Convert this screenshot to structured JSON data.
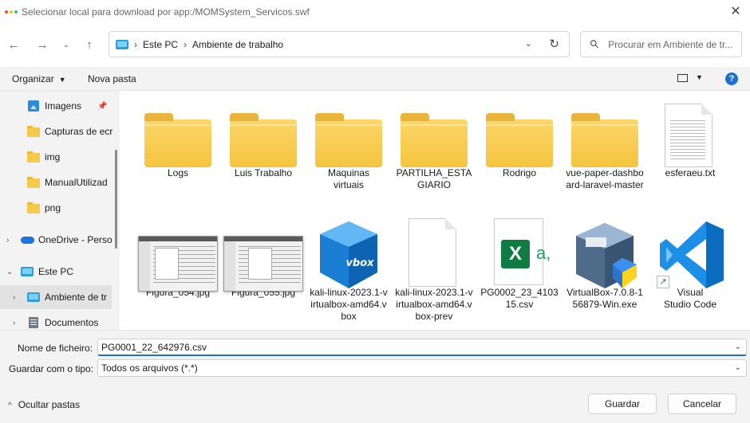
{
  "window": {
    "title": "Selecionar local para download por app:/MOMSystem_Servicos.swf",
    "close_glyph": "✕"
  },
  "nav": {
    "back_icon": "arrow-left-icon",
    "forward_icon": "arrow-right-icon",
    "recent_icon": "chevron-down-icon",
    "up_icon": "arrow-up-icon",
    "breadcrumbs": [
      "Este PC",
      "Ambiente de trabalho"
    ],
    "search_placeholder": "Procurar em Ambiente de tr..."
  },
  "toolbar": {
    "organize_label": "Organizar",
    "new_folder_label": "Nova pasta",
    "help_label": "?"
  },
  "sidebar": {
    "items": [
      {
        "label": "Imagens",
        "icon": "pictures-icon",
        "pinned": true
      },
      {
        "label": "Capturas de ecr",
        "icon": "folder-icon"
      },
      {
        "label": "img",
        "icon": "folder-icon"
      },
      {
        "label": "ManualUtilizad",
        "icon": "folder-icon"
      },
      {
        "label": "png",
        "icon": "folder-icon"
      },
      {
        "label": "OneDrive - Perso",
        "icon": "onedrive-icon",
        "expandable": true
      },
      {
        "label": "Este PC",
        "icon": "this-pc-icon",
        "expanded": true
      },
      {
        "label": "Ambiente de tr",
        "icon": "desktop-icon",
        "selected": true
      },
      {
        "label": "Documentos",
        "icon": "documents-icon"
      }
    ]
  },
  "files": [
    {
      "name": "Logs",
      "type": "folder"
    },
    {
      "name": "Luis Trabalho",
      "type": "folder"
    },
    {
      "name": "Maquinas virtuais",
      "type": "folder"
    },
    {
      "name": "PARTILHA_ESTAGIARIO",
      "type": "folder"
    },
    {
      "name": "Rodrigo",
      "type": "folder"
    },
    {
      "name": "vue-paper-dashboard-laravel-master",
      "type": "folder"
    },
    {
      "name": "esferaeu.txt",
      "type": "text"
    },
    {
      "name": "Figura_054.jpg",
      "type": "image"
    },
    {
      "name": "Figura_055.jpg",
      "type": "image"
    },
    {
      "name": "kali-linux-2023.1-virtualbox-amd64.vbox",
      "type": "vbox"
    },
    {
      "name": "kali-linux-2023.1-virtualbox-amd64.vbox-prev",
      "type": "blank"
    },
    {
      "name": "PG0002_23_410315.csv",
      "type": "excel"
    },
    {
      "name": "VirtualBox-7.0.8-156879-Win.exe",
      "type": "installer"
    },
    {
      "name": "Visual Studio Code",
      "type": "shortcut"
    }
  ],
  "bottom": {
    "filename_label": "Nome de ficheiro:",
    "filename_value": "PG0001_22_642976.csv",
    "type_label": "Guardar com o tipo:",
    "type_value": "Todos os arquivos (*.*)",
    "hide_folders_label": "Ocultar pastas",
    "save_label": "Guardar",
    "cancel_label": "Cancelar"
  },
  "colors": {
    "accent": "#1f6fd1",
    "folder": "#f5c33e",
    "excel": "#107c41",
    "vscode": "#23a9f2"
  }
}
